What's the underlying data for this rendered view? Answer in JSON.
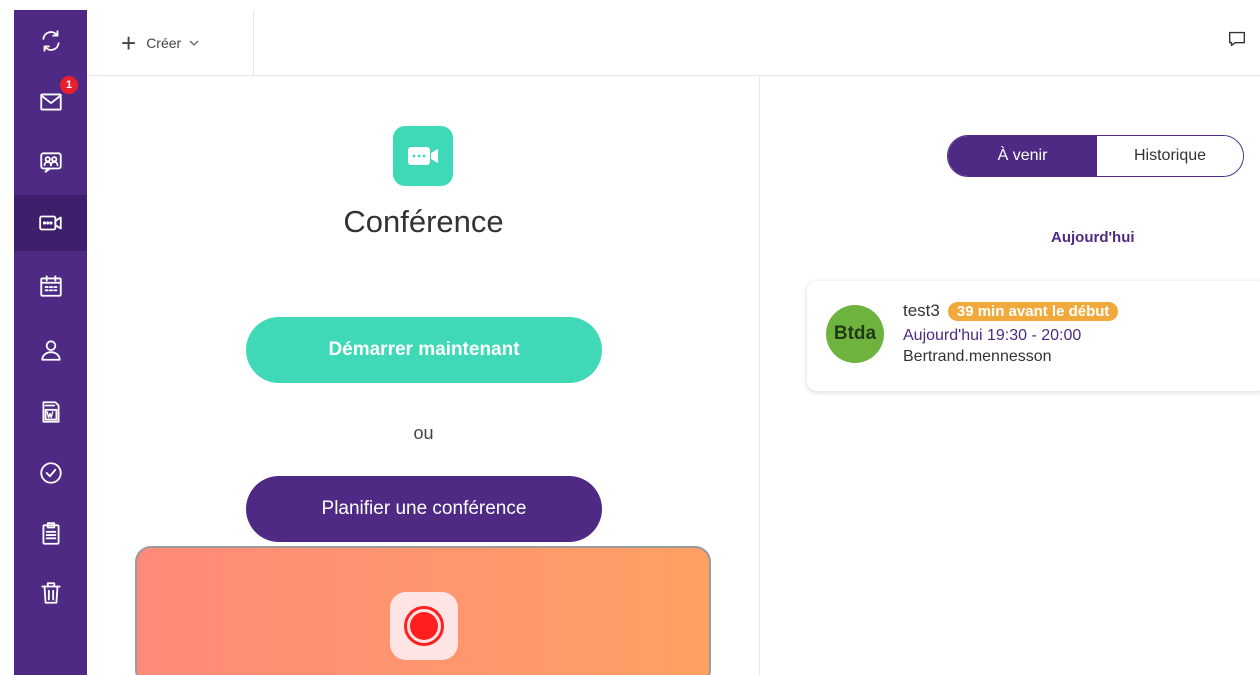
{
  "sidebar": {
    "items": [
      {
        "name": "sync",
        "icon": "sync-icon"
      },
      {
        "name": "mail",
        "icon": "mail-icon",
        "badge": "1"
      },
      {
        "name": "chat",
        "icon": "group-chat-icon"
      },
      {
        "name": "conference",
        "icon": "video-camera-icon"
      },
      {
        "name": "calendar",
        "icon": "calendar-icon"
      },
      {
        "name": "contacts",
        "icon": "person-icon"
      },
      {
        "name": "documents",
        "icon": "word-document-icon"
      },
      {
        "name": "tasks",
        "icon": "check-circle-icon"
      },
      {
        "name": "notes",
        "icon": "clipboard-icon"
      },
      {
        "name": "trash",
        "icon": "trash-icon"
      }
    ],
    "active": "conference",
    "colors": {
      "background": "#4e2a84",
      "active": "#3d1f6b"
    }
  },
  "topbar": {
    "create_label": "Créer"
  },
  "conference": {
    "title": "Conférence",
    "start_button": "Démarrer maintenant",
    "or_text": "ou",
    "plan_button": "Planifier une conférence",
    "accent_color": "#3fd9b8"
  },
  "events": {
    "tabs": [
      {
        "label": "À venir",
        "active": true
      },
      {
        "label": "Historique",
        "active": false
      }
    ],
    "section": "Aujourd'hui",
    "items": [
      {
        "avatar_initials": "Btda",
        "title": "test3",
        "badge": "39 min avant le début",
        "time": "Aujourd'hui 19:30 - 20:00",
        "owner": "Bertrand.mennesson"
      }
    ]
  }
}
